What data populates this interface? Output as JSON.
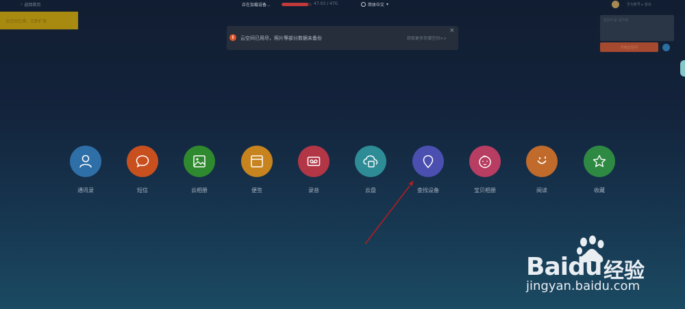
{
  "topbar": {
    "back_text": "返回首页",
    "loading_text": "正在加载设备...",
    "progress_fraction": 0.88,
    "progress_count": "47.03 / 47G",
    "language": "简体中文"
  },
  "yellow_banner": "云空间已满，立即扩容",
  "user": {
    "name": "华为账号 ▸ 退出",
    "card_text": "空间不足 请升级",
    "button_label": "升级云空间"
  },
  "notice": {
    "icon": "!",
    "text": "云空间已用尽，照片等部分数据未备份",
    "link": "获取更多存储空间>>",
    "close": "×"
  },
  "apps": [
    {
      "key": "contacts",
      "label": "通讯录",
      "color": "#2f6fa8",
      "icon": "person-icon"
    },
    {
      "key": "messages",
      "label": "短信",
      "color": "#c8501f",
      "icon": "chat-bubble-icon"
    },
    {
      "key": "gallery",
      "label": "云相册",
      "color": "#2f8a2f",
      "icon": "photo-icon"
    },
    {
      "key": "notes",
      "label": "便签",
      "color": "#c7841e",
      "icon": "note-icon"
    },
    {
      "key": "recordings",
      "label": "录音",
      "color": "#b33647",
      "icon": "tape-icon"
    },
    {
      "key": "drive",
      "label": "云盘",
      "color": "#2e8c96",
      "icon": "cloud-drive-icon"
    },
    {
      "key": "find-device",
      "label": "查找设备",
      "color": "#4b4fb0",
      "icon": "location-pin-icon"
    },
    {
      "key": "baby-album",
      "label": "宝贝相册",
      "color": "#b73d62",
      "icon": "baby-face-icon"
    },
    {
      "key": "reading",
      "label": "阅读",
      "color": "#c06a2c",
      "icon": "smile-icon"
    },
    {
      "key": "favorites",
      "label": "收藏",
      "color": "#2e8a43",
      "icon": "star-icon"
    }
  ],
  "watermark": {
    "brand_bai": "Bai",
    "brand_du": "du",
    "brand_cn": "经验",
    "url": "jingyan.baidu.com"
  },
  "colors": {
    "annotation_arrow": "#b01e24",
    "progress": "#c0393b"
  }
}
